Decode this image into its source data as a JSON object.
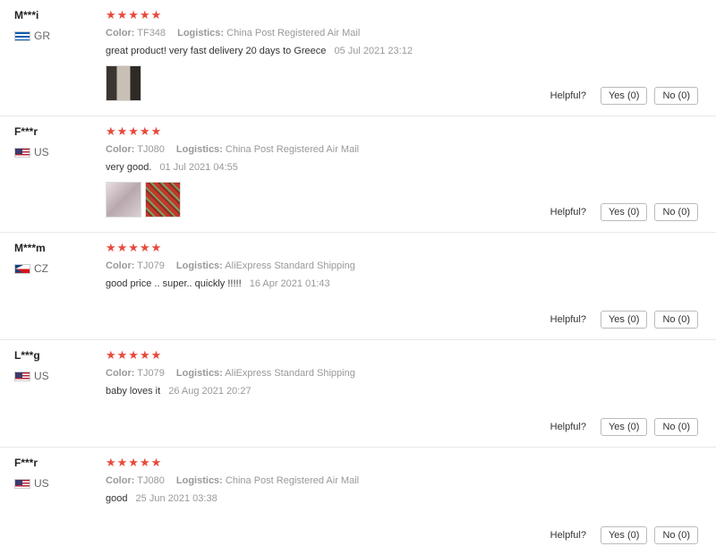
{
  "labels": {
    "color": "Color:",
    "logistics": "Logistics:",
    "helpful": "Helpful?",
    "yes": "Yes (0)",
    "no": "No (0)"
  },
  "reviews": [
    {
      "user": "M***i",
      "country": "GR",
      "stars": "★★★★★",
      "color": "TF348",
      "logistics": "China Post Registered Air Mail",
      "text": "great product! very fast delivery 20 days to Greece",
      "date": "05 Jul 2021 23:12"
    },
    {
      "user": "F***r",
      "country": "US",
      "stars": "★★★★★",
      "color": "TJ080",
      "logistics": "China Post Registered Air Mail",
      "text": "very good.",
      "date": "01 Jul 2021 04:55"
    },
    {
      "user": "M***m",
      "country": "CZ",
      "stars": "★★★★★",
      "color": "TJ079",
      "logistics": "AliExpress Standard Shipping",
      "text": "good price .. super.. quickly !!!!!",
      "date": "16 Apr 2021 01:43"
    },
    {
      "user": "L***g",
      "country": "US",
      "stars": "★★★★★",
      "color": "TJ079",
      "logistics": "AliExpress Standard Shipping",
      "text": "baby loves it",
      "date": "26 Aug 2021 20:27"
    },
    {
      "user": "F***r",
      "country": "US",
      "stars": "★★★★★",
      "color": "TJ080",
      "logistics": "China Post Registered Air Mail",
      "text": "good",
      "date": "25 Jun 2021 03:38"
    }
  ]
}
